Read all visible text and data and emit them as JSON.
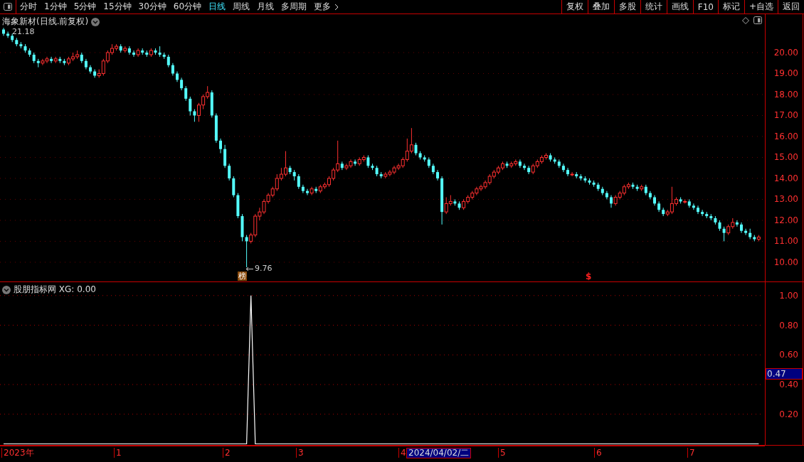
{
  "toolbar": {
    "periods": [
      {
        "label": "分时",
        "selected": false
      },
      {
        "label": "1分钟",
        "selected": false
      },
      {
        "label": "5分钟",
        "selected": false
      },
      {
        "label": "15分钟",
        "selected": false
      },
      {
        "label": "30分钟",
        "selected": false
      },
      {
        "label": "60分钟",
        "selected": false
      },
      {
        "label": "日线",
        "selected": true
      },
      {
        "label": "周线",
        "selected": false
      },
      {
        "label": "月线",
        "selected": false
      },
      {
        "label": "多周期",
        "selected": false
      }
    ],
    "more": "更多",
    "actions": [
      "复权",
      "叠加",
      "多股",
      "统计",
      "画线",
      "F10",
      "标记",
      "+自选",
      "返回"
    ]
  },
  "main_chart": {
    "title": "海象新材(日线.前复权)",
    "high_label": "21.18",
    "low_label": "9.76",
    "markers": [
      {
        "kind": "badge",
        "text": "榜"
      },
      {
        "kind": "signal",
        "text": "$"
      }
    ],
    "chart_data": {
      "type": "candlestick",
      "ylim": [
        9.05,
        21.83
      ],
      "grid": true,
      "yticks": [
        {
          "value": 20,
          "label": "20.00"
        },
        {
          "value": 19,
          "label": "19.00"
        },
        {
          "value": 18,
          "label": "18.00"
        },
        {
          "value": 17,
          "label": "17.00"
        },
        {
          "value": 16,
          "label": "16.00"
        },
        {
          "value": 15,
          "label": "15.00"
        },
        {
          "value": 14,
          "label": "14.00"
        },
        {
          "value": 13,
          "label": "13.00"
        },
        {
          "value": 12,
          "label": "12.00"
        },
        {
          "value": 11,
          "label": "11.00"
        },
        {
          "value": 10,
          "label": "10.00"
        }
      ],
      "ohlc": [
        [
          21.1,
          21.18,
          20.8,
          20.9
        ],
        [
          20.9,
          21.0,
          20.7,
          20.8
        ],
        [
          20.8,
          20.9,
          20.5,
          20.6
        ],
        [
          20.6,
          20.7,
          20.3,
          20.4
        ],
        [
          20.4,
          20.5,
          20.2,
          20.3
        ],
        [
          20.3,
          20.4,
          20.0,
          20.1
        ],
        [
          20.1,
          20.2,
          19.8,
          19.9
        ],
        [
          19.9,
          20.0,
          19.5,
          19.6
        ],
        [
          19.6,
          19.7,
          19.3,
          19.5
        ],
        [
          19.5,
          19.7,
          19.4,
          19.6
        ],
        [
          19.6,
          19.8,
          19.5,
          19.7
        ],
        [
          19.7,
          19.8,
          19.5,
          19.6
        ],
        [
          19.6,
          19.8,
          19.5,
          19.7
        ],
        [
          19.7,
          19.8,
          19.5,
          19.6
        ],
        [
          19.6,
          19.7,
          19.4,
          19.5
        ],
        [
          19.5,
          19.8,
          19.4,
          19.7
        ],
        [
          19.7,
          20.0,
          19.6,
          19.8
        ],
        [
          19.8,
          20.1,
          19.7,
          19.9
        ],
        [
          19.9,
          20.0,
          19.5,
          19.6
        ],
        [
          19.6,
          19.7,
          19.2,
          19.3
        ],
        [
          19.3,
          19.4,
          19.0,
          19.1
        ],
        [
          19.1,
          19.2,
          18.8,
          18.9
        ],
        [
          18.9,
          19.2,
          18.8,
          19.0
        ],
        [
          19.0,
          19.7,
          18.9,
          19.6
        ],
        [
          19.6,
          20.1,
          19.5,
          20.0
        ],
        [
          20.0,
          20.4,
          19.9,
          20.2
        ],
        [
          20.2,
          20.4,
          20.1,
          20.3
        ],
        [
          20.3,
          20.4,
          20.0,
          20.1
        ],
        [
          20.1,
          20.3,
          20.0,
          20.2
        ],
        [
          20.2,
          20.3,
          19.9,
          20.0
        ],
        [
          20.0,
          20.1,
          19.8,
          19.9
        ],
        [
          19.9,
          20.2,
          19.8,
          20.1
        ],
        [
          20.1,
          20.2,
          19.9,
          20.0
        ],
        [
          20.0,
          20.1,
          19.8,
          19.9
        ],
        [
          19.9,
          20.2,
          19.8,
          20.1
        ],
        [
          20.1,
          20.2,
          19.9,
          20.0
        ],
        [
          20.0,
          20.3,
          19.8,
          19.9
        ],
        [
          19.9,
          20.0,
          19.7,
          19.8
        ],
        [
          19.8,
          19.9,
          19.3,
          19.4
        ],
        [
          19.4,
          19.5,
          18.9,
          19.0
        ],
        [
          19.0,
          19.1,
          18.6,
          18.7
        ],
        [
          18.7,
          18.8,
          18.2,
          18.3
        ],
        [
          18.3,
          18.4,
          17.7,
          17.8
        ],
        [
          17.8,
          17.9,
          17.0,
          17.2
        ],
        [
          17.2,
          17.3,
          16.7,
          17.0
        ],
        [
          17.0,
          17.6,
          16.7,
          17.5
        ],
        [
          17.5,
          18.0,
          17.3,
          17.9
        ],
        [
          17.9,
          18.4,
          17.8,
          18.1
        ],
        [
          18.1,
          18.2,
          16.9,
          17.0
        ],
        [
          17.0,
          17.1,
          15.7,
          15.8
        ],
        [
          15.8,
          15.9,
          15.2,
          15.4
        ],
        [
          15.4,
          15.6,
          14.5,
          14.6
        ],
        [
          14.6,
          14.7,
          13.9,
          14.0
        ],
        [
          14.0,
          14.1,
          13.1,
          13.2
        ],
        [
          13.2,
          13.3,
          12.1,
          12.2
        ],
        [
          12.2,
          12.3,
          11.0,
          11.2
        ],
        [
          11.2,
          11.3,
          9.76,
          11.0
        ],
        [
          11.0,
          11.4,
          10.9,
          11.3
        ],
        [
          11.3,
          12.3,
          11.2,
          12.2
        ],
        [
          12.2,
          12.6,
          12.0,
          12.4
        ],
        [
          12.4,
          13.0,
          12.3,
          12.9
        ],
        [
          12.9,
          13.3,
          12.8,
          13.2
        ],
        [
          13.2,
          13.6,
          13.1,
          13.5
        ],
        [
          13.5,
          14.2,
          13.4,
          14.0
        ],
        [
          14.0,
          14.5,
          13.9,
          14.2
        ],
        [
          14.2,
          15.3,
          14.1,
          14.5
        ],
        [
          14.5,
          14.6,
          14.2,
          14.3
        ],
        [
          14.3,
          14.4,
          13.9,
          14.1
        ],
        [
          14.1,
          14.2,
          13.5,
          13.6
        ],
        [
          13.6,
          13.7,
          13.3,
          13.4
        ],
        [
          13.4,
          13.5,
          13.2,
          13.3
        ],
        [
          13.3,
          13.6,
          13.2,
          13.5
        ],
        [
          13.5,
          13.6,
          13.3,
          13.4
        ],
        [
          13.4,
          13.7,
          13.3,
          13.6
        ],
        [
          13.6,
          13.8,
          13.5,
          13.7
        ],
        [
          13.7,
          14.1,
          13.6,
          14.0
        ],
        [
          14.0,
          14.5,
          13.9,
          14.4
        ],
        [
          14.4,
          15.8,
          14.3,
          14.7
        ],
        [
          14.7,
          14.8,
          14.4,
          14.5
        ],
        [
          14.5,
          14.7,
          14.4,
          14.6
        ],
        [
          14.6,
          14.9,
          14.5,
          14.8
        ],
        [
          14.8,
          14.9,
          14.6,
          14.7
        ],
        [
          14.7,
          15.0,
          14.6,
          14.9
        ],
        [
          14.9,
          15.1,
          14.8,
          15.0
        ],
        [
          15.0,
          15.1,
          14.5,
          14.6
        ],
        [
          14.6,
          14.7,
          14.4,
          14.5
        ],
        [
          14.5,
          14.6,
          14.1,
          14.2
        ],
        [
          14.2,
          14.3,
          14.0,
          14.1
        ],
        [
          14.1,
          14.3,
          14.0,
          14.2
        ],
        [
          14.2,
          14.4,
          14.1,
          14.3
        ],
        [
          14.3,
          14.6,
          14.2,
          14.5
        ],
        [
          14.5,
          14.7,
          14.4,
          14.6
        ],
        [
          14.6,
          15.0,
          14.5,
          14.9
        ],
        [
          14.9,
          15.9,
          14.8,
          15.3
        ],
        [
          15.3,
          16.4,
          15.2,
          15.6
        ],
        [
          15.6,
          15.7,
          15.1,
          15.2
        ],
        [
          15.2,
          15.3,
          14.9,
          15.0
        ],
        [
          15.0,
          15.1,
          14.8,
          14.9
        ],
        [
          14.9,
          15.0,
          14.5,
          14.6
        ],
        [
          14.6,
          14.7,
          14.2,
          14.3
        ],
        [
          14.3,
          14.4,
          13.9,
          14.0
        ],
        [
          14.0,
          14.1,
          11.8,
          12.4
        ],
        [
          12.4,
          13.1,
          12.3,
          12.8
        ],
        [
          12.8,
          13.2,
          12.7,
          12.9
        ],
        [
          12.9,
          13.0,
          12.7,
          12.8
        ],
        [
          12.8,
          12.9,
          12.5,
          12.6
        ],
        [
          12.6,
          13.0,
          12.5,
          12.9
        ],
        [
          12.9,
          13.2,
          12.8,
          13.1
        ],
        [
          13.1,
          13.4,
          13.0,
          13.3
        ],
        [
          13.3,
          13.6,
          13.2,
          13.5
        ],
        [
          13.5,
          13.7,
          13.4,
          13.6
        ],
        [
          13.6,
          13.9,
          13.5,
          13.8
        ],
        [
          13.8,
          14.2,
          13.7,
          14.1
        ],
        [
          14.1,
          14.4,
          14.0,
          14.3
        ],
        [
          14.3,
          14.6,
          14.2,
          14.5
        ],
        [
          14.5,
          14.8,
          14.4,
          14.7
        ],
        [
          14.7,
          14.8,
          14.5,
          14.6
        ],
        [
          14.6,
          14.8,
          14.5,
          14.7
        ],
        [
          14.7,
          14.9,
          14.6,
          14.8
        ],
        [
          14.8,
          14.9,
          14.5,
          14.6
        ],
        [
          14.6,
          14.7,
          14.4,
          14.5
        ],
        [
          14.5,
          14.6,
          14.2,
          14.3
        ],
        [
          14.3,
          14.7,
          14.2,
          14.6
        ],
        [
          14.6,
          14.9,
          14.5,
          14.8
        ],
        [
          14.8,
          15.1,
          14.7,
          15.0
        ],
        [
          15.0,
          15.2,
          14.9,
          15.1
        ],
        [
          15.1,
          15.2,
          14.8,
          14.9
        ],
        [
          14.9,
          15.0,
          14.7,
          14.8
        ],
        [
          14.8,
          14.9,
          14.5,
          14.6
        ],
        [
          14.6,
          14.7,
          14.3,
          14.4
        ],
        [
          14.4,
          14.5,
          14.1,
          14.2
        ],
        [
          14.2,
          14.3,
          14.1,
          14.2
        ],
        [
          14.2,
          14.3,
          14.0,
          14.1
        ],
        [
          14.1,
          14.2,
          13.9,
          14.0
        ],
        [
          14.0,
          14.1,
          13.8,
          13.9
        ],
        [
          13.9,
          14.0,
          13.7,
          13.8
        ],
        [
          13.8,
          13.9,
          13.6,
          13.7
        ],
        [
          13.7,
          13.8,
          13.4,
          13.5
        ],
        [
          13.5,
          13.6,
          13.2,
          13.3
        ],
        [
          13.3,
          13.4,
          13.0,
          13.1
        ],
        [
          13.1,
          13.2,
          12.6,
          12.8
        ],
        [
          12.8,
          13.2,
          12.7,
          13.1
        ],
        [
          13.1,
          13.4,
          13.0,
          13.3
        ],
        [
          13.3,
          13.7,
          13.2,
          13.6
        ],
        [
          13.6,
          13.8,
          13.5,
          13.7
        ],
        [
          13.7,
          13.8,
          13.5,
          13.6
        ],
        [
          13.6,
          13.7,
          13.4,
          13.5
        ],
        [
          13.5,
          13.7,
          13.4,
          13.6
        ],
        [
          13.6,
          13.7,
          13.2,
          13.3
        ],
        [
          13.3,
          13.4,
          13.0,
          13.1
        ],
        [
          13.1,
          13.2,
          12.7,
          12.8
        ],
        [
          12.8,
          12.9,
          12.4,
          12.5
        ],
        [
          12.5,
          12.6,
          12.2,
          12.3
        ],
        [
          12.3,
          12.5,
          12.2,
          12.4
        ],
        [
          12.4,
          13.6,
          12.3,
          12.8
        ],
        [
          12.8,
          13.1,
          12.7,
          13.0
        ],
        [
          13.0,
          13.1,
          12.8,
          12.9
        ],
        [
          12.9,
          13.0,
          12.8,
          12.9
        ],
        [
          12.9,
          13.0,
          12.6,
          12.7
        ],
        [
          12.7,
          12.8,
          12.5,
          12.6
        ],
        [
          12.6,
          12.7,
          12.3,
          12.4
        ],
        [
          12.4,
          12.5,
          12.2,
          12.3
        ],
        [
          12.3,
          12.4,
          12.1,
          12.2
        ],
        [
          12.2,
          12.3,
          12.0,
          12.1
        ],
        [
          12.1,
          12.2,
          11.8,
          11.9
        ],
        [
          11.9,
          12.0,
          11.5,
          11.6
        ],
        [
          11.6,
          11.7,
          11.0,
          11.4
        ],
        [
          11.4,
          11.8,
          11.3,
          11.7
        ],
        [
          11.7,
          12.1,
          11.6,
          11.9
        ],
        [
          11.9,
          12.0,
          11.7,
          11.8
        ],
        [
          11.8,
          11.9,
          11.4,
          11.5
        ],
        [
          11.5,
          11.6,
          11.3,
          11.4
        ],
        [
          11.4,
          11.6,
          11.1,
          11.2
        ],
        [
          11.2,
          11.3,
          11.0,
          11.1
        ],
        [
          11.1,
          11.3,
          11.0,
          11.2
        ]
      ]
    }
  },
  "indicator": {
    "title": "股朋指标网 XG: 0.00",
    "current_value": "0.47",
    "chart_data": {
      "type": "line",
      "ylim": [
        0,
        1.09
      ],
      "grid": true,
      "yticks": [
        {
          "value": 1,
          "label": "1.00"
        },
        {
          "value": 0.8,
          "label": "0.80"
        },
        {
          "value": 0.6,
          "label": "0.60"
        },
        {
          "value": 0.4,
          "label": "0.40"
        },
        {
          "value": 0.2,
          "label": "0.20"
        }
      ],
      "series": [
        {
          "color": "#ffffff",
          "values": [
            0,
            0,
            0,
            0,
            0,
            0,
            0,
            0,
            0,
            0,
            0,
            0,
            0,
            0,
            0,
            0,
            0,
            0,
            0,
            0,
            0,
            0,
            0,
            0,
            0,
            0,
            0,
            0,
            0,
            0,
            0,
            0,
            0,
            0,
            0,
            0,
            0,
            0,
            0,
            0,
            0,
            0,
            0,
            0,
            0,
            0,
            0,
            0,
            0,
            0,
            0,
            0,
            0,
            0,
            0,
            0,
            0,
            1,
            0,
            0,
            0,
            0,
            0,
            0,
            0,
            0,
            0,
            0,
            0,
            0,
            0,
            0,
            0,
            0,
            0,
            0,
            0,
            0,
            0,
            0,
            0,
            0,
            0,
            0,
            0,
            0,
            0,
            0,
            0,
            0,
            0,
            0,
            0,
            0,
            0,
            0,
            0,
            0,
            0,
            0,
            0,
            0,
            0,
            0,
            0,
            0,
            0,
            0,
            0,
            0,
            0,
            0,
            0,
            0,
            0,
            0,
            0,
            0,
            0,
            0,
            0,
            0,
            0,
            0,
            0,
            0,
            0,
            0,
            0,
            0,
            0,
            0,
            0,
            0,
            0,
            0,
            0,
            0,
            0,
            0,
            0,
            0,
            0,
            0,
            0,
            0,
            0,
            0,
            0,
            0,
            0,
            0,
            0,
            0,
            0,
            0,
            0,
            0,
            0,
            0,
            0,
            0,
            0,
            0,
            0,
            0,
            0,
            0,
            0,
            0,
            0,
            0,
            0,
            0,
            0
          ]
        }
      ]
    }
  },
  "date_axis": {
    "labels": [
      "2023年",
      "1",
      "2",
      "3",
      "4",
      "5",
      "6",
      "7"
    ],
    "cursor_date": "2024/04/02/二"
  }
}
